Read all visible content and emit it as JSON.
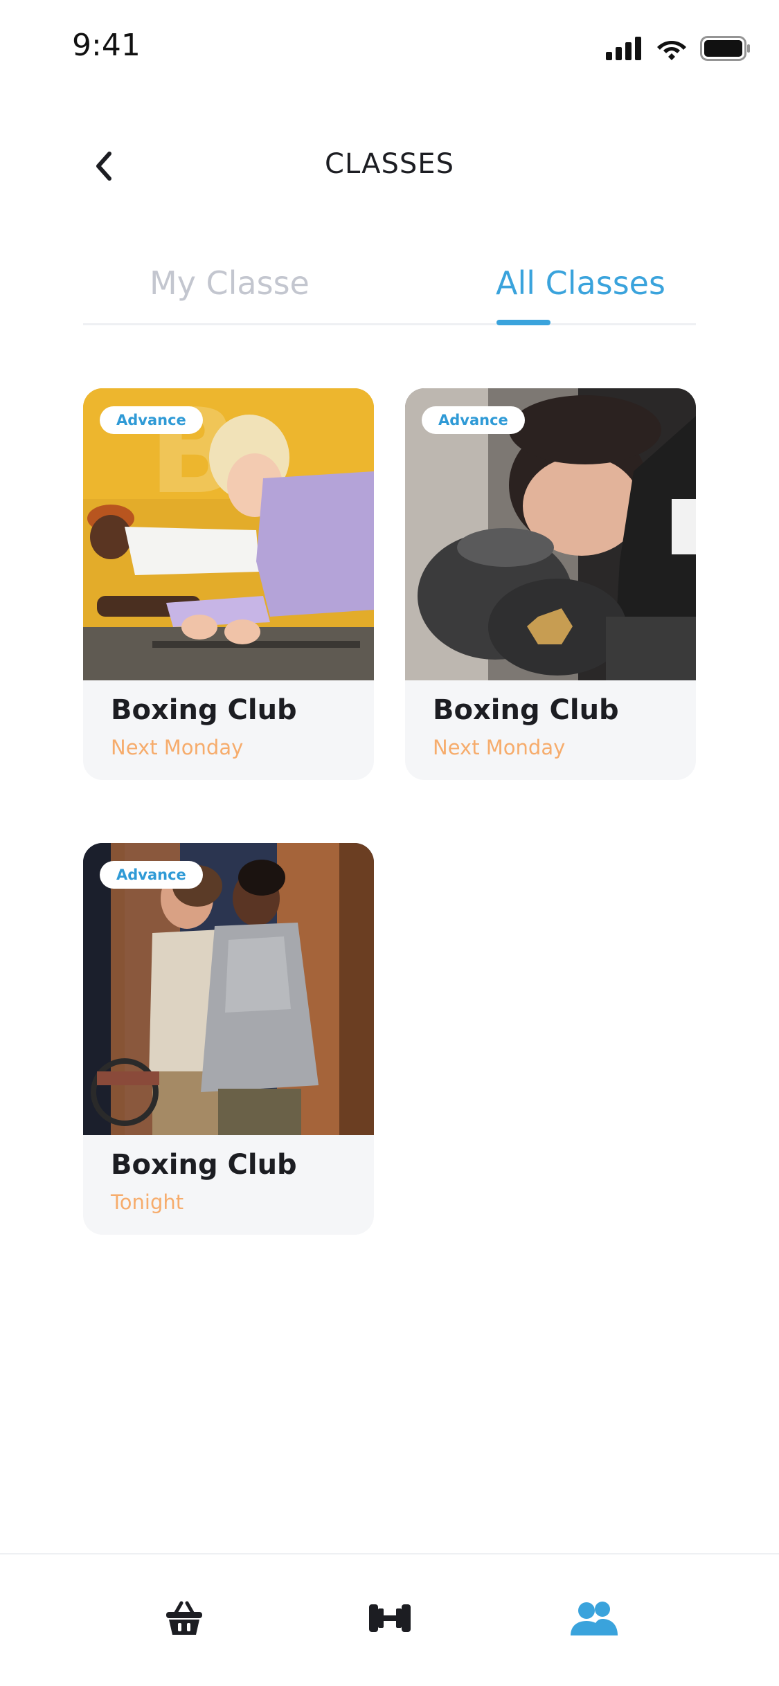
{
  "status_bar": {
    "time": "9:41"
  },
  "header": {
    "title": "CLASSES"
  },
  "tabs": [
    {
      "label": "My Classe",
      "active": false
    },
    {
      "label": "All Classes",
      "active": true
    }
  ],
  "cards": [
    {
      "badge": "Advance",
      "title": "Boxing Club",
      "subtitle": "Next Monday",
      "image": "plank-workout-photo"
    },
    {
      "badge": "Advance",
      "title": "Boxing Club",
      "subtitle": "Next Monday",
      "image": "boxer-gloves-photo"
    },
    {
      "badge": "Advance",
      "title": "Boxing Club",
      "subtitle": "Tonight",
      "image": "two-men-walking-photo"
    }
  ],
  "bottom_nav": [
    {
      "icon": "basket-icon",
      "active": false
    },
    {
      "icon": "dumbbell-icon",
      "active": false
    },
    {
      "icon": "users-icon",
      "active": true
    }
  ],
  "colors": {
    "accent": "#3aa3dc",
    "subtitle": "#f6ac6c",
    "inactive_tab": "#c3c6cf",
    "card_bg": "#f5f6f8"
  }
}
